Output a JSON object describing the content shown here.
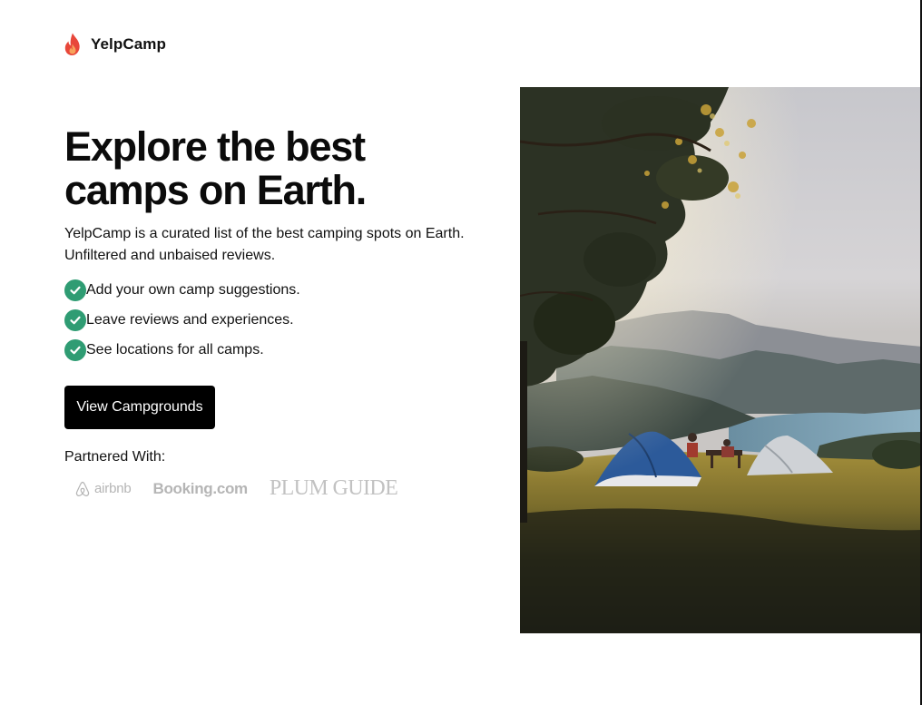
{
  "brand": {
    "name": "YelpCamp",
    "icon": "flame-icon",
    "icon_color": "#e8473a"
  },
  "hero": {
    "title": "Explore the best camps on Earth.",
    "description": "YelpCamp is a curated list of the best camping spots on Earth. Unfiltered and unbaised reviews.",
    "features": [
      {
        "icon": "check-circle-icon",
        "text": "Add your own camp suggestions."
      },
      {
        "icon": "check-circle-icon",
        "text": "Leave reviews and experiences."
      },
      {
        "icon": "check-circle-icon",
        "text": "See locations for all camps."
      }
    ],
    "check_color": "#2f9c73",
    "cta_label": "View Campgrounds"
  },
  "partners": {
    "label": "Partnered With:",
    "logos": [
      {
        "name": "airbnb",
        "icon": "airbnb-logo"
      },
      {
        "name": "Booking.com",
        "icon": "booking-logo"
      },
      {
        "name": "PLUM GUIDE",
        "icon": "plum-guide-logo"
      }
    ]
  },
  "photo": {
    "alt": "camping tents on a grassy hill overlooking a lake and mountains"
  }
}
